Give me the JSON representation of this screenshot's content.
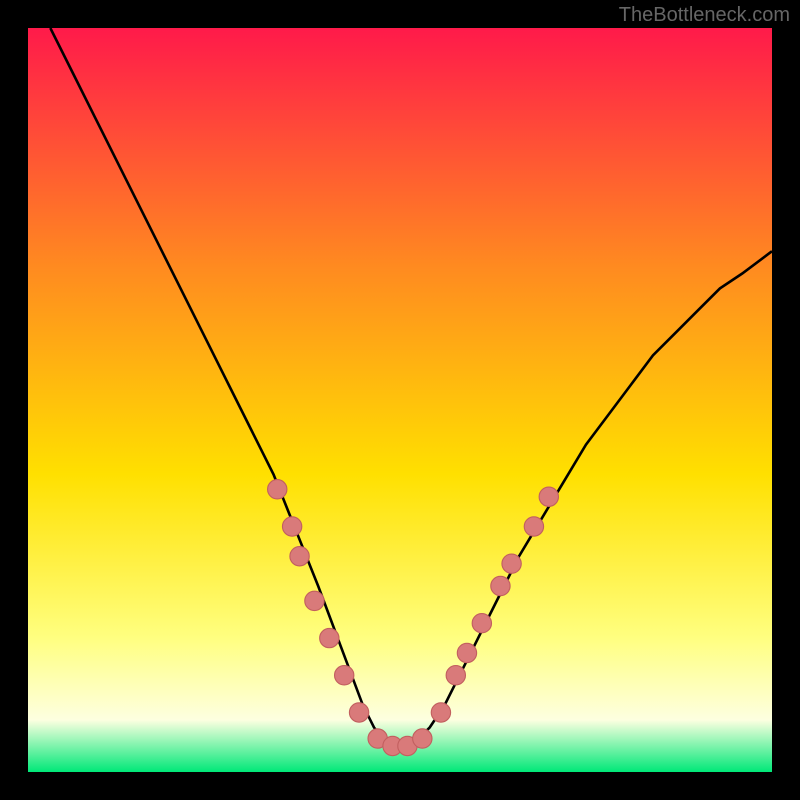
{
  "watermark": "TheBottleneck.com",
  "colors": {
    "bg_top": "#ff1a4a",
    "bg_mid1": "#ff8a20",
    "bg_mid2": "#ffe000",
    "bg_mid3": "#ffff80",
    "bg_low": "#fdffe0",
    "bg_bottom": "#00e878",
    "curve": "#000000",
    "marker_fill": "#d97a7a",
    "marker_stroke": "#c25f5f"
  },
  "chart_data": {
    "type": "line",
    "title": "",
    "xlabel": "",
    "ylabel": "",
    "xlim": [
      0,
      100
    ],
    "ylim": [
      0,
      100
    ],
    "curve": {
      "x": [
        3,
        6,
        9,
        12,
        15,
        18,
        21,
        24,
        27,
        30,
        33,
        35,
        37,
        39,
        40.5,
        42,
        43.5,
        45,
        46.5,
        48,
        50,
        52,
        54,
        56,
        58,
        60,
        63,
        66,
        69,
        72,
        75,
        78,
        81,
        84,
        87,
        90,
        93,
        96,
        100
      ],
      "y": [
        100,
        94,
        88,
        82,
        76,
        70,
        64,
        58,
        52,
        46,
        40,
        35,
        30,
        25,
        21,
        17,
        13,
        9,
        6,
        4,
        3,
        4,
        6,
        9,
        13,
        17,
        23,
        29,
        34,
        39,
        44,
        48,
        52,
        56,
        59,
        62,
        65,
        67,
        70
      ]
    },
    "markers": [
      {
        "x": 33.5,
        "y": 38
      },
      {
        "x": 35.5,
        "y": 33
      },
      {
        "x": 36.5,
        "y": 29
      },
      {
        "x": 38.5,
        "y": 23
      },
      {
        "x": 40.5,
        "y": 18
      },
      {
        "x": 42.5,
        "y": 13
      },
      {
        "x": 44.5,
        "y": 8
      },
      {
        "x": 47,
        "y": 4.5
      },
      {
        "x": 49,
        "y": 3.5
      },
      {
        "x": 51,
        "y": 3.5
      },
      {
        "x": 53,
        "y": 4.5
      },
      {
        "x": 55.5,
        "y": 8
      },
      {
        "x": 57.5,
        "y": 13
      },
      {
        "x": 59,
        "y": 16
      },
      {
        "x": 61,
        "y": 20
      },
      {
        "x": 63.5,
        "y": 25
      },
      {
        "x": 65,
        "y": 28
      },
      {
        "x": 68,
        "y": 33
      },
      {
        "x": 70,
        "y": 37
      }
    ],
    "marker_radius_pct": 1.3
  }
}
